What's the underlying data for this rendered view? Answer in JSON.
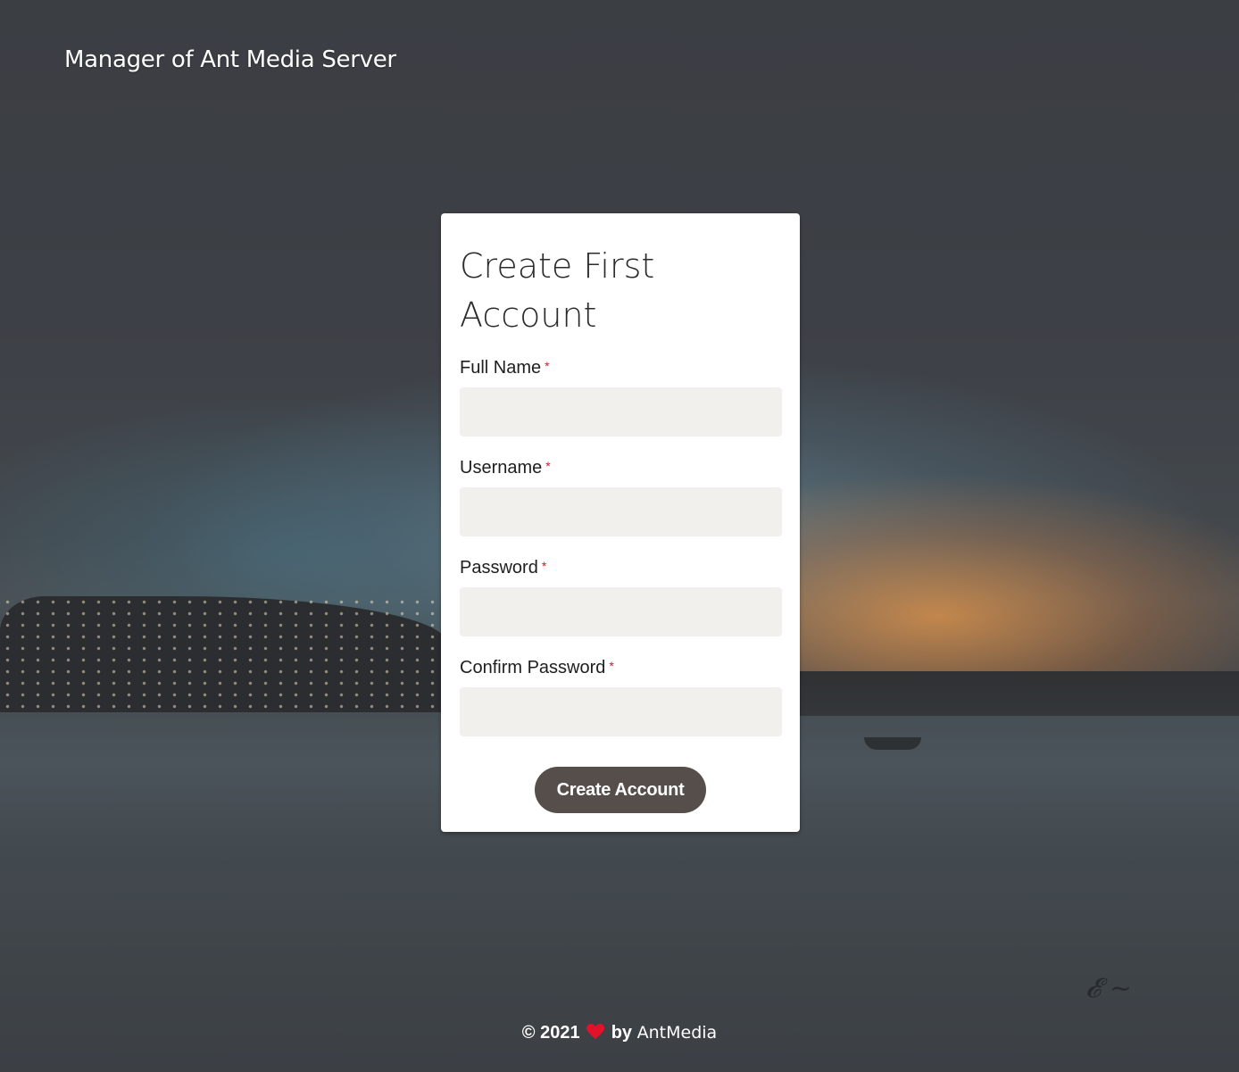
{
  "header": {
    "brand_title": "Manager of Ant Media Server"
  },
  "form": {
    "title": "Create First Account",
    "required_marker": "*",
    "fields": [
      {
        "label": "Full Name",
        "value": "",
        "placeholder": ""
      },
      {
        "label": "Username",
        "value": "",
        "placeholder": ""
      },
      {
        "label": "Password",
        "value": "",
        "placeholder": ""
      },
      {
        "label": "Confirm Password",
        "value": "",
        "placeholder": ""
      }
    ],
    "submit_label": "Create Account"
  },
  "footer": {
    "copyright": "© 2021",
    "heart_icon": "heart-icon",
    "by": "by",
    "company": "AntMedia"
  },
  "colors": {
    "button_bg": "#554e4a",
    "required": "#e3112a",
    "input_bg": "#f1f0ec"
  }
}
